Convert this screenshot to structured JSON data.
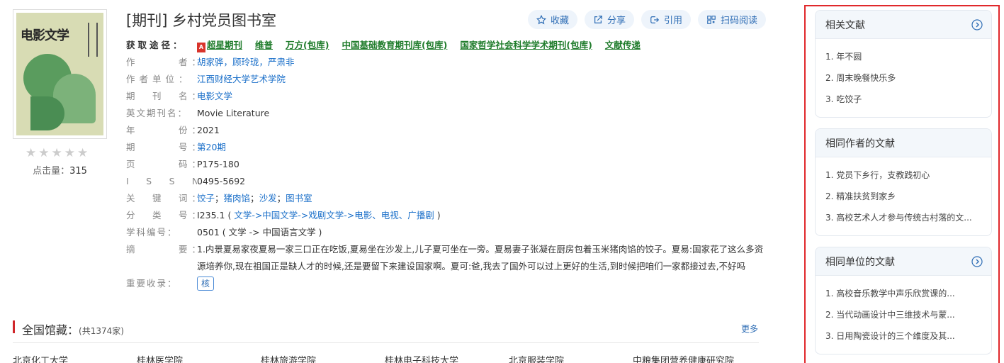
{
  "cover": {
    "title_text": "电影文学"
  },
  "rating": {
    "stars": 0,
    "max": 5
  },
  "clicks": {
    "label": "点击量：",
    "count": "315"
  },
  "title": "[期刊] 乡村党员图书室",
  "actions": {
    "favorite": "收藏",
    "share": "分享",
    "cite": "引用",
    "scan": "扫码阅读"
  },
  "meta": {
    "get_label": "获取途径：",
    "get_links": [
      "超星期刊",
      "维普",
      "万方(包库)",
      "中国基础教育期刊库(包库)",
      "国家哲学社会科学学术期刊(包库)",
      "文献传递"
    ],
    "author_label": "作　　　者：",
    "authors": "胡家骅，顾玲珑，严肃非",
    "unit_label": "作者单位：",
    "unit": "江西财经大学艺术学院",
    "journal_label": "期　刊　名：",
    "journal": "电影文学",
    "en_journal_label": "英文期刊名：",
    "en_journal": "Movie Literature",
    "year_label": "年　　　份：",
    "year": "2021",
    "issue_label": "期　　　号：",
    "issue": "第20期",
    "pages_label": "页　　　码：",
    "pages": "P175-180",
    "issn_label": "I　S　S　N：",
    "issn": "0495-5692",
    "keywords_label": "关　键　词：",
    "keywords": [
      "饺子",
      "猪肉馅",
      "沙发",
      "图书室"
    ],
    "class_label": "分　类　号：",
    "class_code": "I235.1",
    "class_path": "文学->中国文学->戏剧文学->电影、电视、广播剧",
    "subject_label": "学科编号：",
    "subject": "0501 ( 文学 -> 中国语言文学 )",
    "abstract_label": "摘　　　要：",
    "abstract": "1.内景夏易家夜夏易一家三口正在吃饭,夏易坐在沙发上,儿子夏可坐在一旁。夏易妻子张凝在厨房包着玉米猪肉馅的饺子。夏易:国家花了这么多资源培养你,现在祖国正是缺人才的时候,还是要留下来建设国家啊。夏可:爸,我去了国外可以过上更好的生活,到时候把咱们一家都接过去,不好吗",
    "index_label": "重要收录：",
    "index_badge": "核"
  },
  "holdings": {
    "title": "全国馆藏：",
    "count": "(共1374家)",
    "more": "更多",
    "libraries": [
      "北京化工大学",
      "桂林医学院",
      "桂林旅游学院",
      "桂林电子科技大学",
      "北京服装学院",
      "中粮集团营养健康研究院"
    ]
  },
  "sidebar": {
    "related": {
      "title": "相关文献",
      "items": [
        "1. 年不圆",
        "2. 周末晚餐快乐多",
        "3. 吃饺子"
      ]
    },
    "same_author": {
      "title": "相同作者的文献",
      "items": [
        "1. 党员下乡行，支教践初心",
        "2. 精准扶贫到家乡",
        "3. 高校艺术人才参与传统古村落的文..."
      ]
    },
    "same_unit": {
      "title": "相同单位的文献",
      "items": [
        "1. 高校音乐教学中声乐欣赏课的...",
        "2. 当代动画设计中三维技术与蒙...",
        "3. 日用陶瓷设计的三个维度及其..."
      ]
    }
  },
  "colors": {
    "link": "#1a6fc9",
    "get_link": "#1e7b2a",
    "highlight_frame": "#e0282b",
    "holdings_bar": "#d0262a"
  }
}
